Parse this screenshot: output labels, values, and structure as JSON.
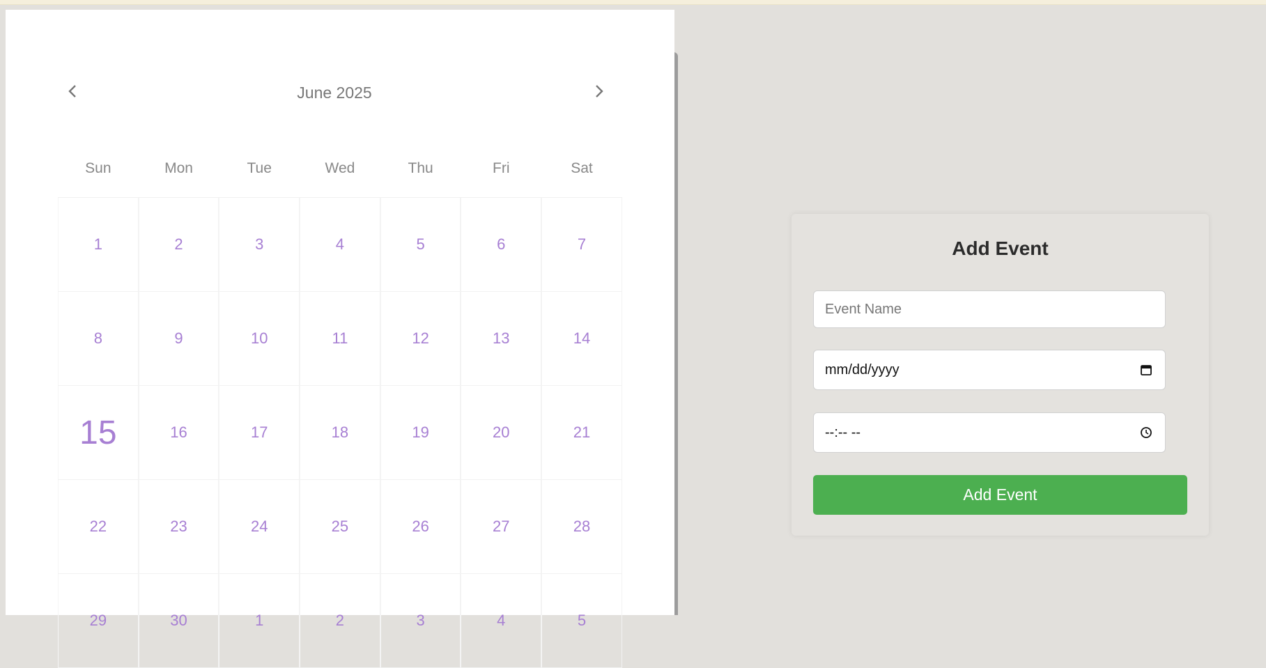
{
  "calendar": {
    "month_title": "June 2025",
    "prev_icon": "chevron-left-icon",
    "next_icon": "chevron-right-icon",
    "weekdays": [
      "Sun",
      "Mon",
      "Tue",
      "Wed",
      "Thu",
      "Fri",
      "Sat"
    ],
    "today": "15",
    "day_color": "#a77fd3",
    "days": [
      "1",
      "2",
      "3",
      "4",
      "5",
      "6",
      "7",
      "8",
      "9",
      "10",
      "11",
      "12",
      "13",
      "14",
      "15",
      "16",
      "17",
      "18",
      "19",
      "20",
      "21",
      "22",
      "23",
      "24",
      "25",
      "26",
      "27",
      "28",
      "29",
      "30",
      "1",
      "2",
      "3",
      "4",
      "5"
    ]
  },
  "event_form": {
    "title": "Add Event",
    "name_placeholder": "Event Name",
    "date_value": "mm/dd/yyyy",
    "date_icon": "calendar-icon",
    "time_value": "--:-- --",
    "time_icon": "clock-icon",
    "submit_label": "Add Event",
    "submit_color": "#4caf50"
  }
}
